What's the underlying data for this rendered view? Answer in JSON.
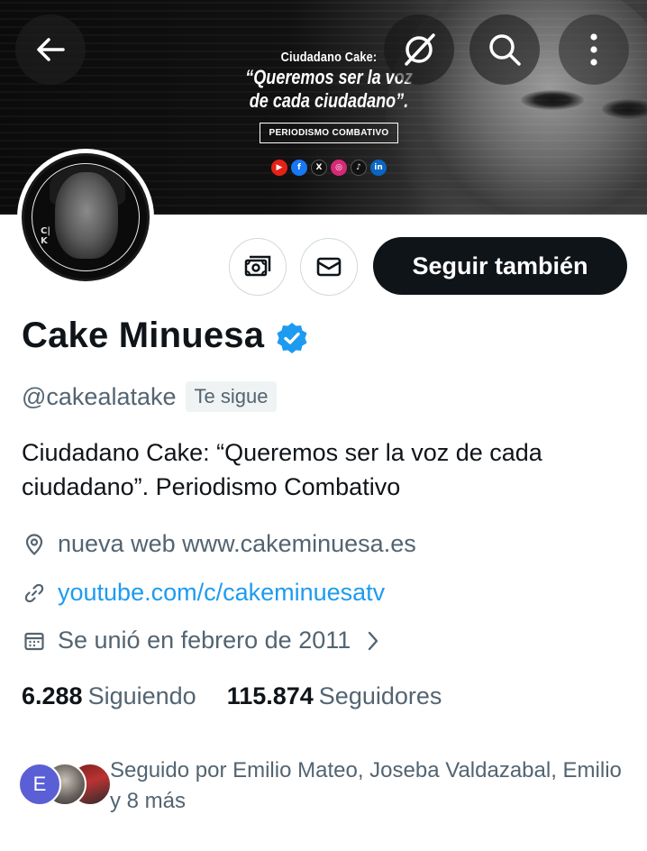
{
  "banner": {
    "title": "Ciudadano Cake:",
    "quote_line1": "“Queremos ser la voz",
    "quote_line2": "de cada ciudadano”.",
    "tag": "PERIODISMO COMBATIVO",
    "social_icons": [
      "youtube-icon",
      "facebook-icon",
      "x-icon",
      "instagram-icon",
      "tiktok-icon",
      "linkedin-icon"
    ]
  },
  "topbar": {
    "icons": [
      "back-arrow-icon",
      "grok-icon",
      "search-icon",
      "more-vertical-icon"
    ]
  },
  "actions": {
    "follow_label": "Seguir también"
  },
  "profile": {
    "name": "Cake Minuesa",
    "handle": "@cakealatake",
    "follows_you": "Te sigue",
    "bio": "Ciudadano Cake: “Queremos ser la voz de cada ciudadano”.  Periodismo Combativo",
    "location": "nueva web www.cakeminuesa.es",
    "url": "youtube.com/c/cakeminuesatv",
    "joined": "Se unió en febrero de 2011"
  },
  "stats": {
    "following_count": "6.288",
    "following_label": "Siguiendo",
    "followers_count": "115.874",
    "followers_label": "Seguidores"
  },
  "followed_by": {
    "avatar_letter": "E",
    "text": "Seguido por Emilio Mateo, Joseba Valdazabal, Emilio y 8 más"
  },
  "colors": {
    "accent": "#1d9bf0",
    "verified": "#1d9bf0",
    "text_primary": "#0f1419",
    "text_secondary": "#536471",
    "follow_button": "#0f1419"
  }
}
